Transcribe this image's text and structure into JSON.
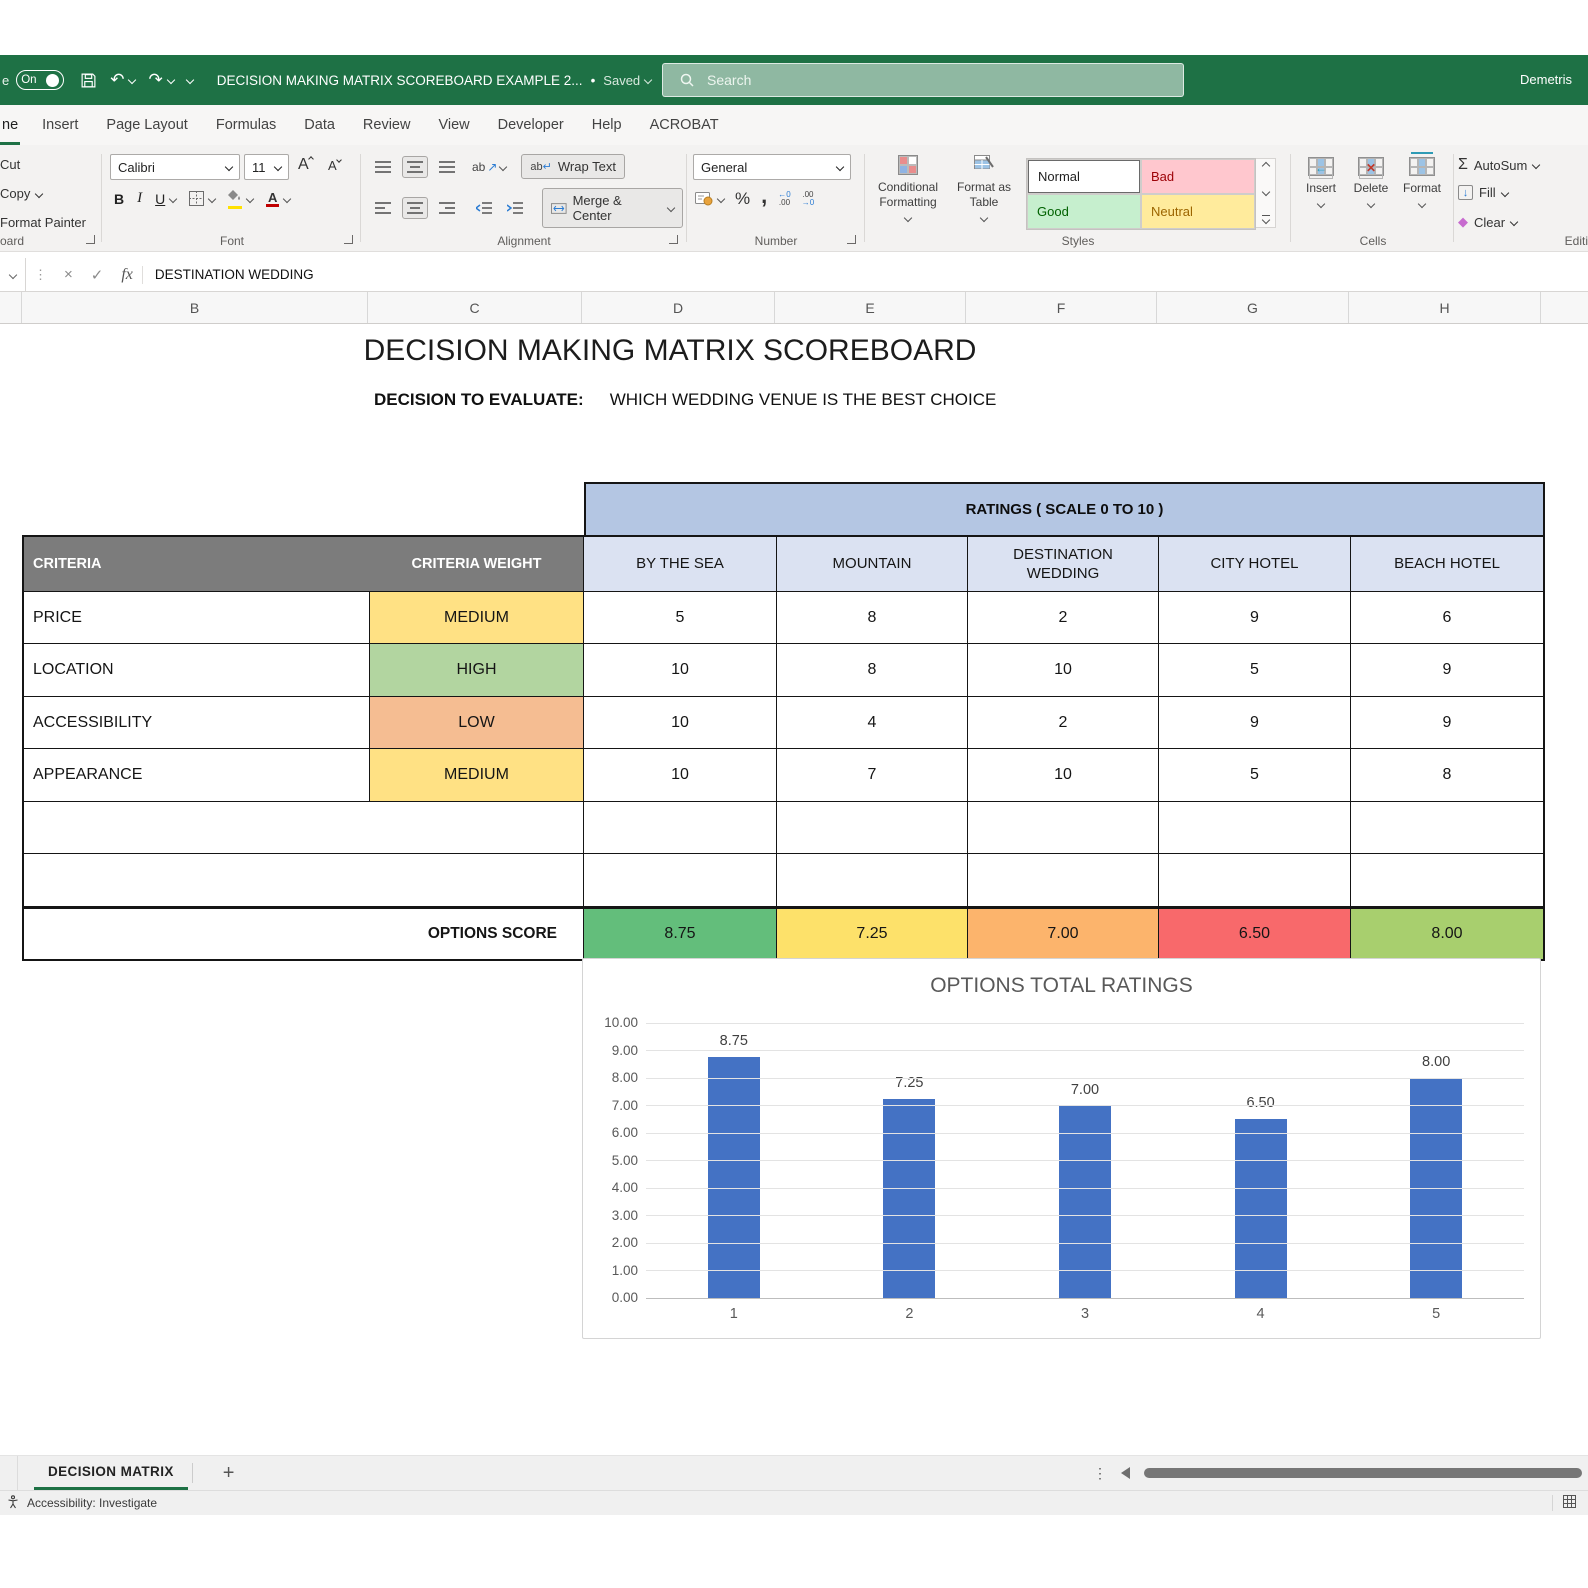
{
  "title_bar": {
    "autosave_cut_label": "e",
    "autosave_state": "On",
    "document_title": "DECISION MAKING MATRIX SCOREBOARD EXAMPLE 2...",
    "bullet": "•",
    "saved_status": "Saved",
    "search_placeholder": "Search",
    "user_name": "Demetris"
  },
  "menu_tabs": [
    {
      "label": "ne",
      "active": true
    },
    {
      "label": "Insert"
    },
    {
      "label": "Page Layout"
    },
    {
      "label": "Formulas"
    },
    {
      "label": "Data"
    },
    {
      "label": "Review"
    },
    {
      "label": "View"
    },
    {
      "label": "Developer"
    },
    {
      "label": "Help"
    },
    {
      "label": "ACROBAT"
    }
  ],
  "ribbon": {
    "clipboard": {
      "cut_label": "Cut",
      "copy_label": "Copy",
      "format_painter_label": "Format Painter",
      "group_label": "oard"
    },
    "font": {
      "font_name": "Calibri",
      "font_size": "11",
      "bold_label": "B",
      "italic_label": "I",
      "underline_label": "U",
      "group_label": "Font"
    },
    "alignment": {
      "orientation_label": "ab",
      "wrap_text_label": "Wrap Text",
      "merge_center_label": "Merge & Center",
      "group_label": "Alignment"
    },
    "number": {
      "format_value": "General",
      "percent_label": "%",
      "comma_label": ",",
      "group_label": "Number"
    },
    "styles": {
      "conditional_formatting_label": "Conditional Formatting",
      "format_as_table_label": "Format as Table",
      "style_normal": "Normal",
      "style_bad": "Bad",
      "style_good": "Good",
      "style_neutral": "Neutral",
      "group_label": "Styles"
    },
    "cells": {
      "insert_label": "Insert",
      "delete_label": "Delete",
      "format_label": "Format",
      "group_label": "Cells"
    },
    "editing": {
      "autosum_label": "AutoSum",
      "fill_label": "Fill",
      "clear_label": "Clear",
      "group_label": "Editi"
    }
  },
  "formula_bar": {
    "value": "DESTINATION WEDDING",
    "fx_label": "fx"
  },
  "column_headers": [
    "B",
    "C",
    "D",
    "E",
    "F",
    "G",
    "H"
  ],
  "sheet": {
    "main_title": "DECISION MAKING MATRIX SCOREBOARD",
    "decision_label": "DECISION TO EVALUATE:",
    "decision_value": "WHICH WEDDING VENUE IS THE BEST CHOICE"
  },
  "matrix_table": {
    "ratings_banner": "RATINGS ( SCALE 0 TO 10 )",
    "criteria_header": "CRITERIA",
    "weight_header": "CRITERIA WEIGHT",
    "options": [
      "BY THE SEA",
      "MOUNTAIN",
      "DESTINATION WEDDING",
      "CITY HOTEL",
      "BEACH HOTEL"
    ],
    "rows": [
      {
        "criteria": "PRICE",
        "weight": "MEDIUM",
        "ratings": [
          5,
          8,
          2,
          9,
          6
        ]
      },
      {
        "criteria": "LOCATION",
        "weight": "HIGH",
        "ratings": [
          10,
          8,
          10,
          5,
          9
        ]
      },
      {
        "criteria": "ACCESSIBILITY",
        "weight": "LOW",
        "ratings": [
          10,
          4,
          2,
          9,
          9
        ]
      },
      {
        "criteria": "APPEARANCE",
        "weight": "MEDIUM",
        "ratings": [
          10,
          7,
          10,
          5,
          8
        ]
      }
    ],
    "score_label": "OPTIONS SCORE",
    "scores": [
      "8.75",
      "7.25",
      "7.00",
      "6.50",
      "8.00"
    ]
  },
  "chart_data": {
    "type": "bar",
    "title": "OPTIONS TOTAL RATINGS",
    "categories": [
      "1",
      "2",
      "3",
      "4",
      "5"
    ],
    "values": [
      8.75,
      7.25,
      7.0,
      6.5,
      8.0
    ],
    "data_labels": [
      "8.75",
      "7.25",
      "7.00",
      "6.50",
      "8.00"
    ],
    "xlabel": "",
    "ylabel": "",
    "ylim": [
      0,
      10
    ],
    "ytick_step": 1,
    "ytick_labels": [
      "0.00",
      "1.00",
      "2.00",
      "3.00",
      "4.00",
      "5.00",
      "6.00",
      "7.00",
      "8.00",
      "9.00",
      "10.00"
    ],
    "bar_color": "#4472c4",
    "grid": true,
    "legend": false
  },
  "sheet_tabs": {
    "active_tab": "DECISION MATRIX",
    "add_sheet_label": "+"
  },
  "status_bar": {
    "accessibility_label": "Accessibility: Investigate"
  },
  "colors": {
    "titlebar_green": "#1e7145",
    "banner_blue": "#b4c6e3",
    "option_header_blue": "#dbe2f2",
    "criteria_header_gray": "#7c7c7c",
    "weight_medium_yellow": "#ffe184",
    "weight_high_green": "#b2d5a0",
    "weight_low_orange": "#f5bd92",
    "score_colors": [
      "#63be7b",
      "#fde16a",
      "#fcb46c",
      "#f8696b",
      "#a8cf6e"
    ],
    "bar_blue": "#4472c4"
  }
}
